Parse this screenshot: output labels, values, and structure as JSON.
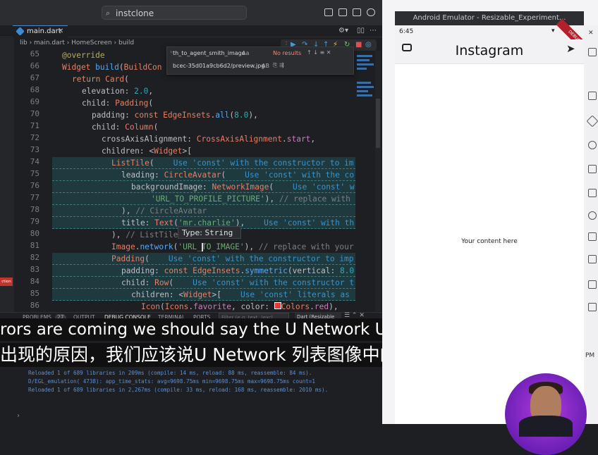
{
  "vscode": {
    "search_text": "instclone",
    "tab_label": "main.dart",
    "breadcrumb": "lib  ›  main.dart  ›  HomeScreen  ›  build",
    "find": {
      "query": "th_to_agent_smith_image",
      "aa": "Aa",
      "results": "No results",
      "replace": "bcec-35d01a9cb6d2/preview.jpg",
      "ab": "AB"
    },
    "tooltip_label": "Type:",
    "tooltip_type": "String",
    "panel_tabs": [
      "PROBLEMS",
      "27",
      "OUTPUT",
      "DEBUG CONSOLE",
      "TERMINAL",
      "PORTS"
    ],
    "filter_placeholder": "Filter (e.g. text, !excl...",
    "dart_select": "Dart (Resizable",
    "console_lines": [
      "Reloaded 1 of 689 libraries in 209ms (compile: 14 ms, reload: 88 ms, reassemble: 84 ms).",
      "D/EGL_emulation( 4738): app_time_stats: avg=9698.75ms min=9698.75ms max=9698.75ms count=1",
      "Reloaded 1 of 689 libraries in 2,267ms (compile: 33 ms, reload: 168 ms, reassemble: 2010 ms)."
    ],
    "left_error_badge": "ction",
    "line_numbers": [
      "65",
      "66",
      "67",
      "68",
      "69",
      "70",
      "71",
      "72",
      "73",
      "74",
      "75",
      "76",
      "77",
      "78",
      "79",
      "80",
      "81",
      "82",
      "83",
      "84",
      "85",
      "86"
    ]
  },
  "subtitles": {
    "english": "rors are coming we should say the U Network URL here in the list",
    "chinese": "出现的原因，我们应该说U Network 列表图像中的 URL"
  },
  "emulator": {
    "window_title": "Android Emulator - Resizable_Experiment...",
    "time": "6:45",
    "app_title": "Instagram",
    "body_text": "Your content here",
    "debug_banner": "DEBUG",
    "side_time": "PM"
  },
  "colors": {
    "accent": "#3b8cd3",
    "error": "#c5312b",
    "avatar_bg": "#8e2fd0"
  }
}
